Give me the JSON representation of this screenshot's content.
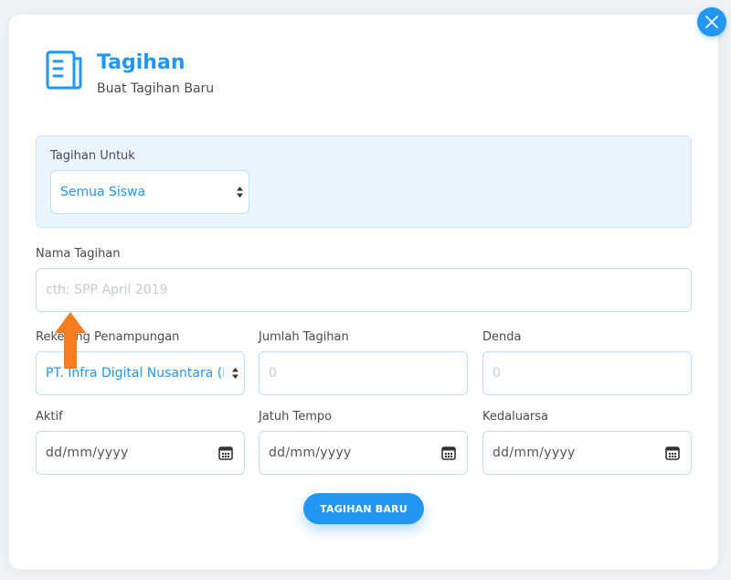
{
  "header": {
    "title": "Tagihan",
    "subtitle": "Buat Tagihan Baru",
    "icon": "document-icon"
  },
  "target": {
    "label": "Tagihan Untuk",
    "selected": "Semua Siswa"
  },
  "bill_name": {
    "label": "Nama Tagihan",
    "placeholder": "cth: SPP April 2019"
  },
  "account": {
    "label": "Rekening Penampungan",
    "selected": "PT. Infra Digital Nusantara (BA"
  },
  "amount": {
    "label": "Jumlah Tagihan",
    "placeholder": "0"
  },
  "fine": {
    "label": "Denda",
    "placeholder": "0"
  },
  "active": {
    "label": "Aktif",
    "value": "dd/mm/yyyy"
  },
  "due": {
    "label": "Jatuh Tempo",
    "value": "dd/mm/yyyy"
  },
  "expiry": {
    "label": "Kedaluarsa",
    "value": "dd/mm/yyyy"
  },
  "submit": {
    "label": "TAGIHAN BARU"
  },
  "colors": {
    "accent": "#2196f3",
    "panel": "#eaf5fd",
    "annotation_arrow": "#f57c1f"
  }
}
